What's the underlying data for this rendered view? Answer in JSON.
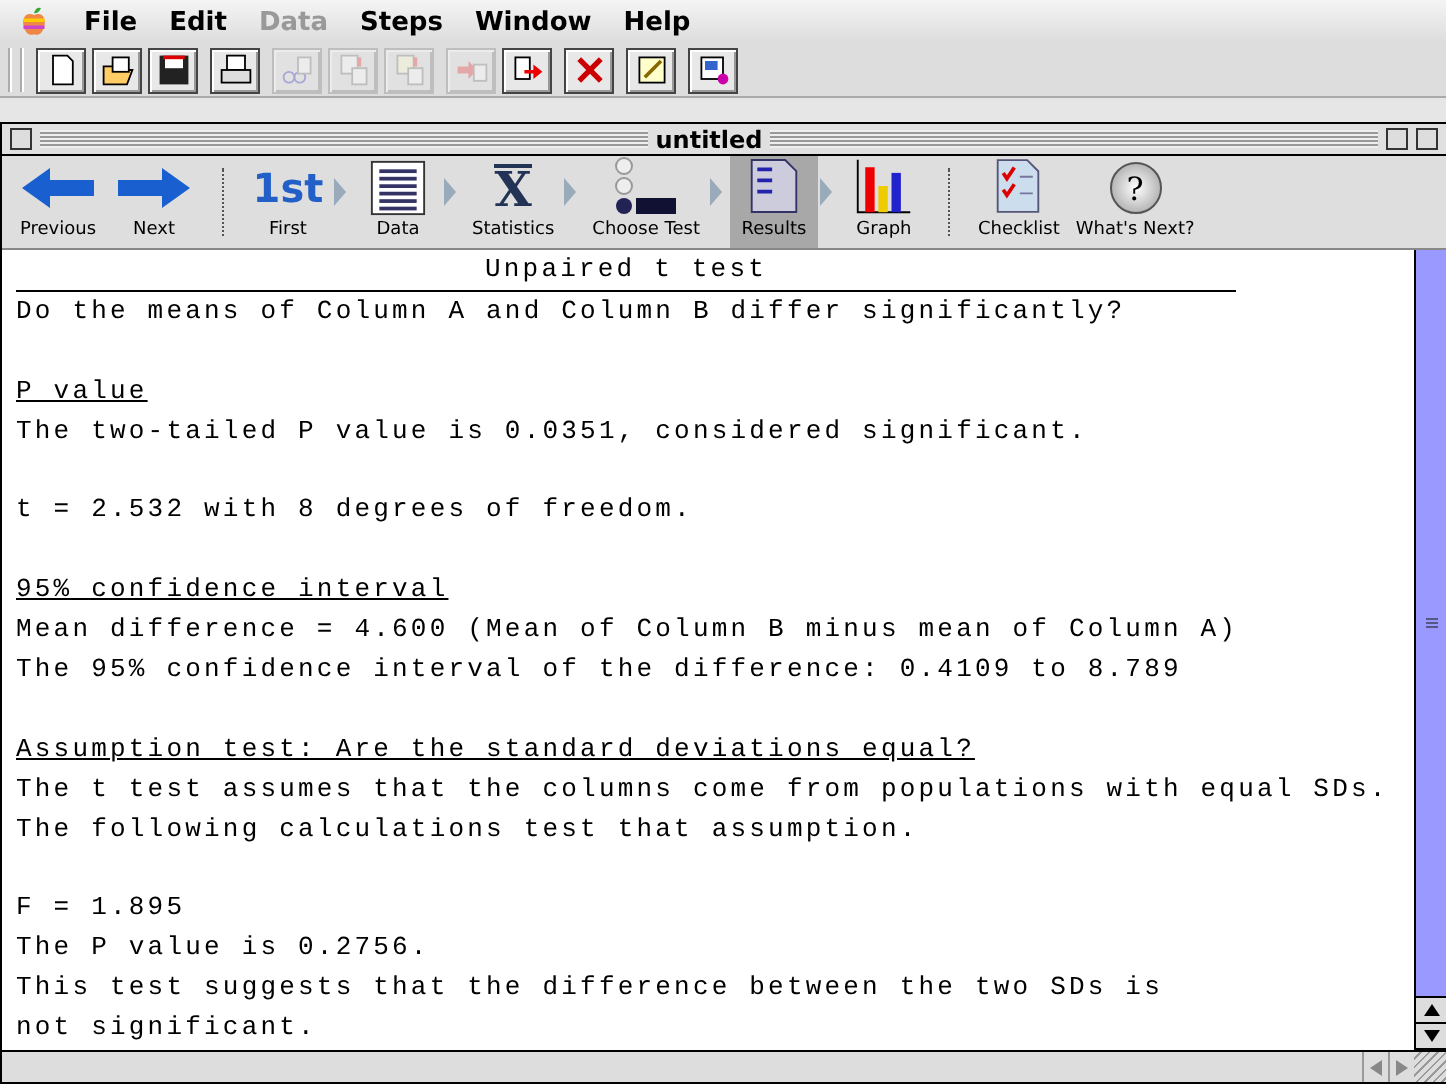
{
  "menu_bar": {
    "items": [
      {
        "label": "File",
        "disabled": false
      },
      {
        "label": "Edit",
        "disabled": false
      },
      {
        "label": "Data",
        "disabled": true
      },
      {
        "label": "Steps",
        "disabled": false
      },
      {
        "label": "Window",
        "disabled": false
      },
      {
        "label": "Help",
        "disabled": false
      }
    ]
  },
  "toolbar": {
    "groups": [
      [
        {
          "kind": "new",
          "disabled": false
        },
        {
          "kind": "open",
          "disabled": false
        },
        {
          "kind": "save",
          "disabled": false
        }
      ],
      [
        {
          "kind": "print",
          "disabled": false
        }
      ],
      [
        {
          "kind": "cut",
          "disabled": true
        },
        {
          "kind": "copy",
          "disabled": true
        },
        {
          "kind": "paste",
          "disabled": true
        }
      ],
      [
        {
          "kind": "import",
          "disabled": true
        },
        {
          "kind": "export",
          "disabled": false
        }
      ],
      [
        {
          "kind": "delete",
          "disabled": false
        }
      ],
      [
        {
          "kind": "notes",
          "disabled": false
        }
      ],
      [
        {
          "kind": "layout",
          "disabled": false
        }
      ]
    ]
  },
  "window": {
    "title": "untitled"
  },
  "steps": [
    {
      "kind": "back",
      "label": "Previous",
      "selected": false
    },
    {
      "kind": "forward",
      "label": "Next",
      "selected": false
    },
    {
      "kind": "sep"
    },
    {
      "kind": "first",
      "label": "First",
      "glyph": "1st",
      "selected": false
    },
    {
      "kind": "data",
      "label": "Data",
      "selected": false
    },
    {
      "kind": "stats",
      "label": "Statistics",
      "glyph": "X",
      "selected": false
    },
    {
      "kind": "choose",
      "label": "Choose Test",
      "selected": false
    },
    {
      "kind": "results",
      "label": "Results",
      "selected": true
    },
    {
      "kind": "graph",
      "label": "Graph",
      "selected": false
    },
    {
      "kind": "sep"
    },
    {
      "kind": "checklist",
      "label": "Checklist",
      "selected": false
    },
    {
      "kind": "help",
      "label": "What's Next?",
      "glyph": "?",
      "selected": false
    }
  ],
  "report": {
    "title": "Unpaired t test",
    "sections": [
      {
        "lines": [
          "Do the means of Column A and Column B differ significantly?"
        ]
      },
      {
        "heading": "P value",
        "lines": [
          "The two-tailed P value is 0.0351, considered significant."
        ]
      },
      {
        "lines": [
          "t = 2.532 with 8 degrees of freedom."
        ]
      },
      {
        "heading": "95% confidence interval",
        "lines": [
          "Mean difference = 4.600 (Mean of Column B minus mean of Column A)",
          "The 95% confidence interval of the difference: 0.4109 to 8.789"
        ]
      },
      {
        "heading": "Assumption test: Are the standard deviations equal?",
        "lines": [
          "The t test assumes that the columns come from populations with equal SDs.",
          "The following calculations test that assumption."
        ]
      },
      {
        "lines": [
          "F = 1.895",
          "The P value is 0.2756.",
          "This test suggests that the difference between the two SDs is",
          "not significant."
        ]
      }
    ]
  }
}
